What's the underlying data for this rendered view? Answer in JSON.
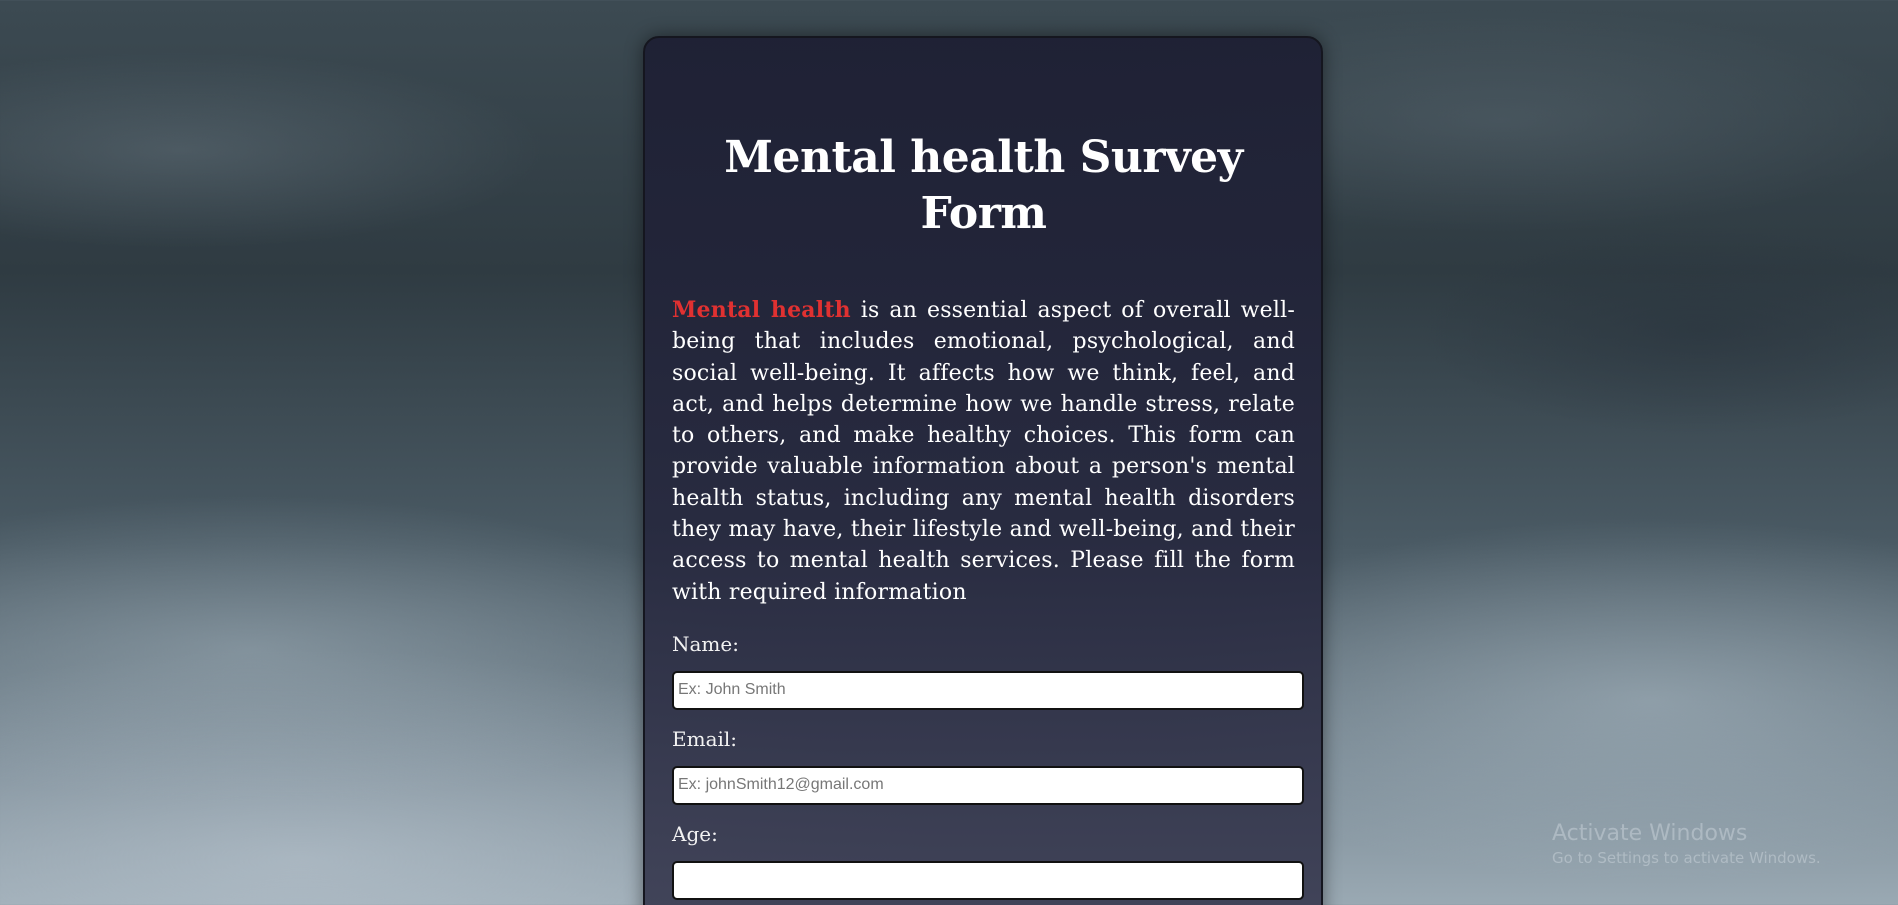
{
  "form": {
    "title": "Mental health Survey Form",
    "intro_highlight": "Mental health",
    "intro_text": " is an essential aspect of overall well-being that includes emotional, psychological, and social well-being. It affects how we think, feel, and act, and helps determine how we handle stress, relate to others, and make healthy choices. This form can provide valuable information about a person's mental health status, including any mental health disorders they may have, their lifestyle and well-being, and their access to mental health services. Please fill the form with required information",
    "accent_color": "#e03131",
    "fields": {
      "name": {
        "label": "Name:",
        "placeholder": "Ex: John Smith",
        "value": ""
      },
      "email": {
        "label": "Email:",
        "placeholder": "Ex: johnSmith12@gmail.com",
        "value": ""
      },
      "age": {
        "label": "Age:",
        "placeholder": "",
        "value": ""
      }
    }
  },
  "watermark": {
    "title": "Activate Windows",
    "subtitle": "Go to Settings to activate Windows."
  }
}
